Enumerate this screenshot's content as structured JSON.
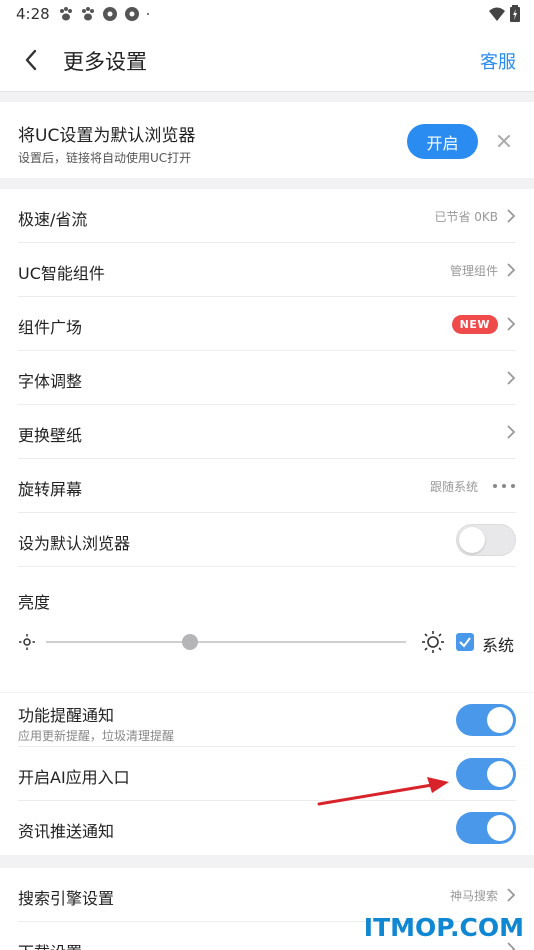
{
  "status_bar": {
    "time": "4:28"
  },
  "header": {
    "title": "更多设置",
    "service_label": "客服"
  },
  "default_banner": {
    "title": "将UC设置为默认浏览器",
    "subtitle": "设置后，链接将自动使用UC打开",
    "button_label": "开启"
  },
  "settings": {
    "speed": {
      "label": "极速/省流",
      "hint": "已节省 0KB"
    },
    "widgets": {
      "label": "UC智能组件",
      "hint": "管理组件"
    },
    "widget_plaza": {
      "label": "组件广场",
      "badge": "NEW"
    },
    "font": {
      "label": "字体调整"
    },
    "wallpaper": {
      "label": "更换壁纸"
    },
    "rotate": {
      "label": "旋转屏幕",
      "hint": "跟随系统"
    },
    "default_browser": {
      "label": "设为默认浏览器",
      "on": false
    },
    "brightness": {
      "label": "亮度",
      "system_label": "系统",
      "level": 0.4,
      "system_checked": true
    }
  },
  "notifications": {
    "feature": {
      "label": "功能提醒通知",
      "sub": "应用更新提醒，垃圾清理提醒",
      "on": true
    },
    "ai_entry": {
      "label": "开启AI应用入口",
      "on": true
    },
    "news": {
      "label": "资讯推送通知",
      "on": true
    }
  },
  "more": {
    "search_engine": {
      "label": "搜索引擎设置",
      "hint": "神马搜索"
    },
    "download": {
      "label": "下载设置"
    }
  },
  "watermark": "ITMOP.COM",
  "colors": {
    "accent": "#2a8cf0",
    "toggle_on": "#4a98ea",
    "badge_red": "#f04b4b",
    "arrow_red": "#d9232a"
  }
}
